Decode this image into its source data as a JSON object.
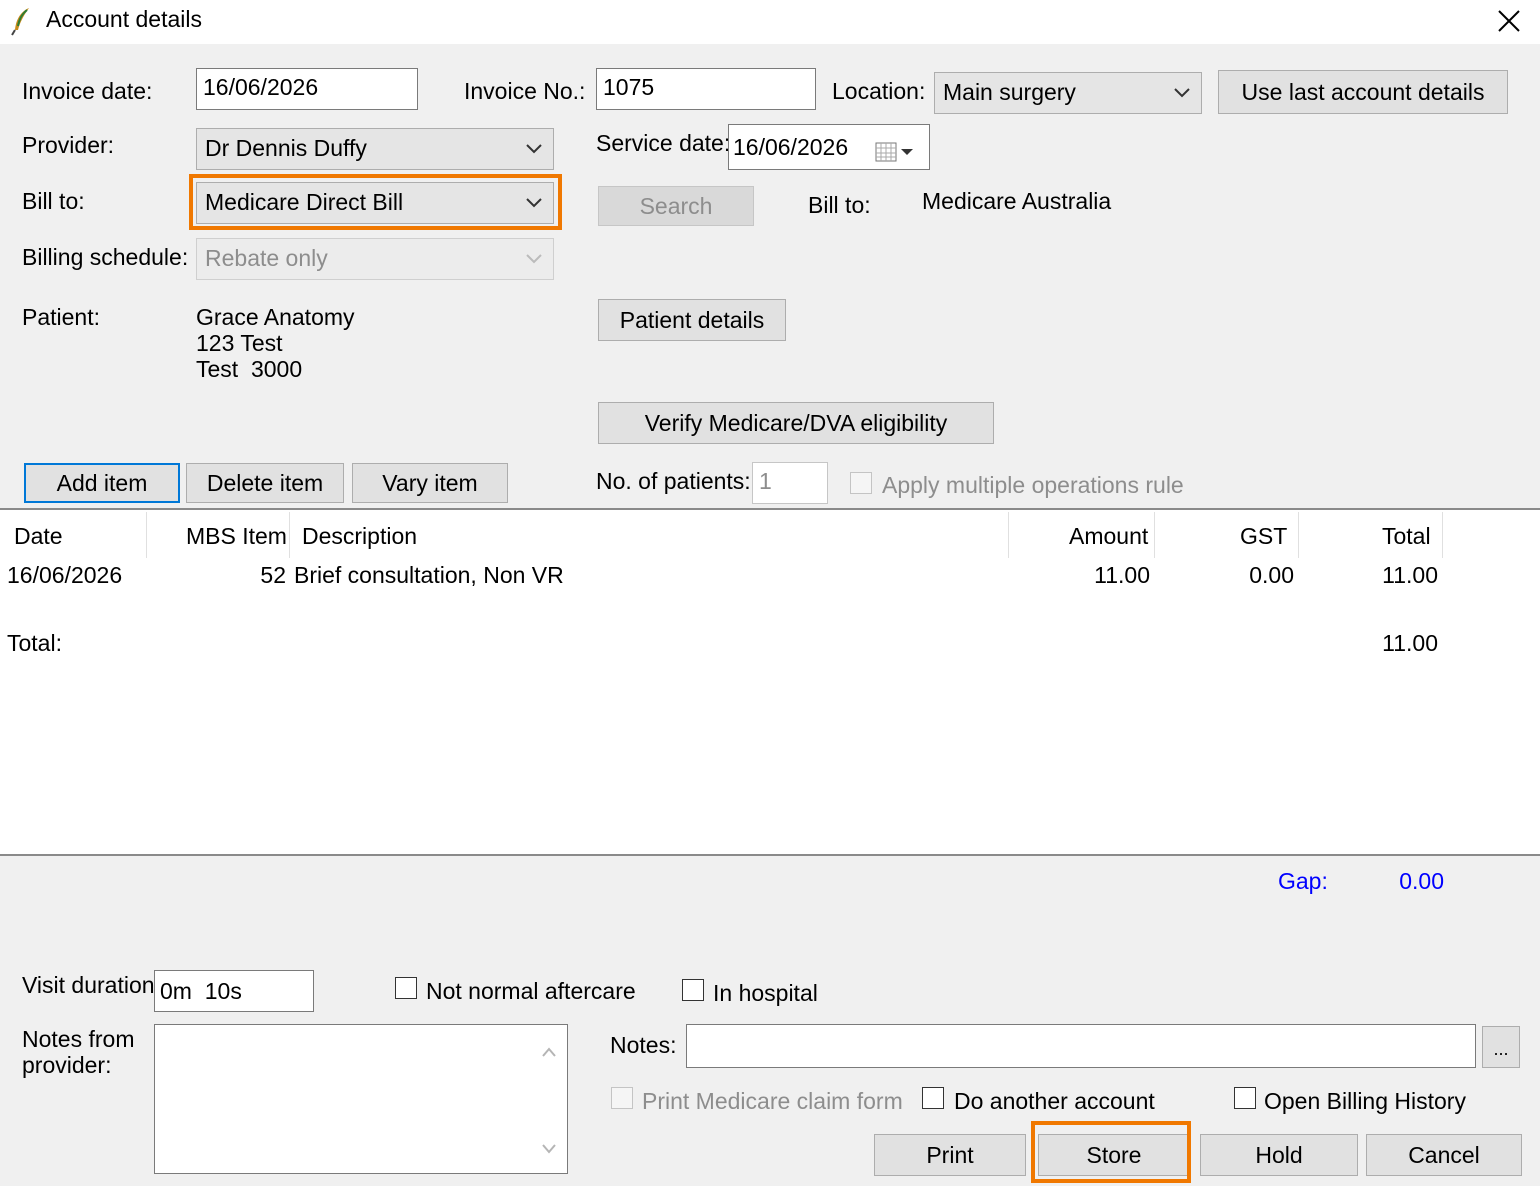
{
  "window": {
    "title": "Account details",
    "app_icon": "feather-icon",
    "close_icon": "close-icon"
  },
  "form": {
    "invoice_date_label": "Invoice date:",
    "invoice_date": "16/06/2026",
    "invoice_no_label": "Invoice No.:",
    "invoice_no": "1075",
    "location_label": "Location:",
    "location": "Main surgery",
    "use_last_button": "Use last account details",
    "provider_label": "Provider:",
    "provider": "Dr Dennis Duffy",
    "service_date_label": "Service date:",
    "service_date": "16/06/2026",
    "bill_to_label": "Bill to:",
    "bill_to": "Medicare Direct Bill",
    "search_button": "Search",
    "bill_to_label_2": "Bill to:",
    "bill_to_value": "Medicare Australia",
    "billing_schedule_label": "Billing schedule:",
    "billing_schedule": "Rebate only",
    "patient_label": "Patient:",
    "patient_name": "Grace Anatomy",
    "patient_address1": "123 Test",
    "patient_address2": "Test  3000",
    "patient_details_button": "Patient details",
    "verify_button": "Verify Medicare/DVA eligibility"
  },
  "items_toolbar": {
    "add": "Add item",
    "delete": "Delete item",
    "vary": "Vary item",
    "no_patients_label": "No. of patients:",
    "no_patients": "1",
    "multi_ops_label": "Apply multiple operations rule"
  },
  "table": {
    "headers": {
      "date": "Date",
      "mbs": "MBS Item",
      "desc": "Description",
      "amount": "Amount",
      "gst": "GST",
      "total": "Total"
    },
    "rows": [
      {
        "date": "16/06/2026",
        "mbs": "52",
        "desc": "Brief consultation, Non VR",
        "amount": "11.00",
        "gst": "0.00",
        "total": "11.00"
      }
    ],
    "total_label": "Total:",
    "total_value": "11.00"
  },
  "gap": {
    "label": "Gap:",
    "value": "0.00",
    "color": "#0000ff"
  },
  "bottom": {
    "visit_duration_label": "Visit duration:",
    "visit_duration": "0m  10s",
    "not_normal_aftercare": "Not normal aftercare",
    "in_hospital": "In hospital",
    "notes_from_provider_label_1": "Notes from",
    "notes_from_provider_label_2": "provider:",
    "notes_label": "Notes:",
    "notes_value": "",
    "ellipsis": "...",
    "print_medicare": "Print Medicare claim form",
    "do_another": "Do another account",
    "open_billing_history": "Open Billing History"
  },
  "actions": {
    "print": "Print",
    "store": "Store",
    "hold": "Hold",
    "cancel": "Cancel"
  },
  "colors": {
    "highlight": "#f07800",
    "focus": "#0078d7"
  }
}
